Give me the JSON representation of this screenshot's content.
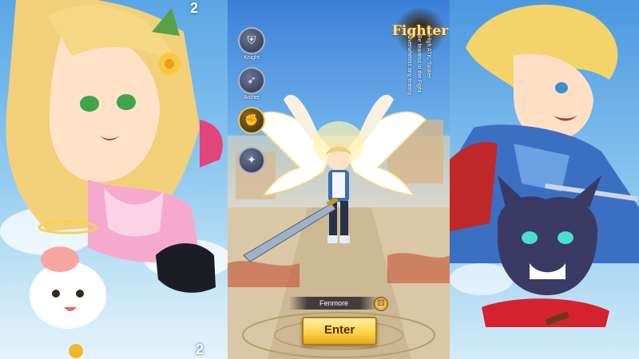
{
  "class_menu": {
    "items": [
      {
        "label": "Knight",
        "icon": "knight-helmet-icon",
        "active": false
      },
      {
        "label": "Archer",
        "icon": "bow-icon",
        "active": false
      },
      {
        "label": "",
        "icon": "fist-icon",
        "active": true
      },
      {
        "label": "",
        "icon": "staff-icon",
        "active": false
      }
    ]
  },
  "selected_class": {
    "title": "Fighter",
    "descriptions": [
      "High ATK, Tanker",
      "Be fearless in the Fight",
      "Overwhelms any enemy"
    ]
  },
  "character": {
    "name": "Fenmore",
    "dice_icon": "dice-icon"
  },
  "enter_button": {
    "label": "Enter"
  },
  "left_panel": {
    "corner_text_top": "2",
    "corner_text_bottom": "2"
  },
  "colors": {
    "accent_gold": "#f2c44d",
    "enter_gold": "#ffd34a",
    "sky_blue": "#5aa6e6"
  }
}
